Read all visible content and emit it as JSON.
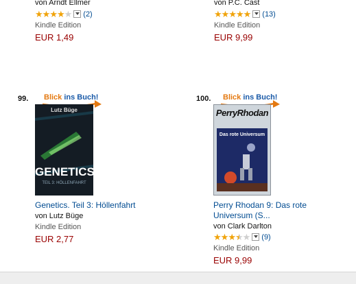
{
  "top_row": [
    {
      "author": "von Arndt Ellmer",
      "rating": 4,
      "review_count": "(2)",
      "format": "Kindle Edition",
      "price": "EUR 1,49"
    },
    {
      "author": "von P.C. Cast",
      "rating": 5,
      "review_count": "(13)",
      "format": "Kindle Edition",
      "price": "EUR 9,99"
    }
  ],
  "products": [
    {
      "rank": "99.",
      "badge_part1": "Blick",
      "badge_part2": "ins Buch!",
      "cover_author": "Lutz Büge",
      "cover_title": "GENETICS",
      "cover_subtitle": "TEIL 3: HÖLLENFAHRT",
      "title_line1": "Genetics. Teil 3: Höllenfahrt",
      "title_line2": "",
      "author": "von Lutz Büge",
      "format": "Kindle Edition",
      "price": "EUR 2,77"
    },
    {
      "rank": "100.",
      "badge_part1": "Blick",
      "badge_part2": "ins Buch!",
      "cover_brand": "PerryRhodan",
      "cover_title": "Das rote Universum",
      "title_line1": "Perry Rhodan 9: Das rote",
      "title_line2": "Universum (S...",
      "author": "von Clark Darlton",
      "rating": 3.5,
      "review_count": "(9)",
      "format": "Kindle Edition",
      "price": "EUR 9,99"
    }
  ],
  "colors": {
    "price": "#990000",
    "link": "#004b91",
    "star": "#f0a30a",
    "badge_orange": "#e47911",
    "badge_blue": "#1a5aa8"
  }
}
